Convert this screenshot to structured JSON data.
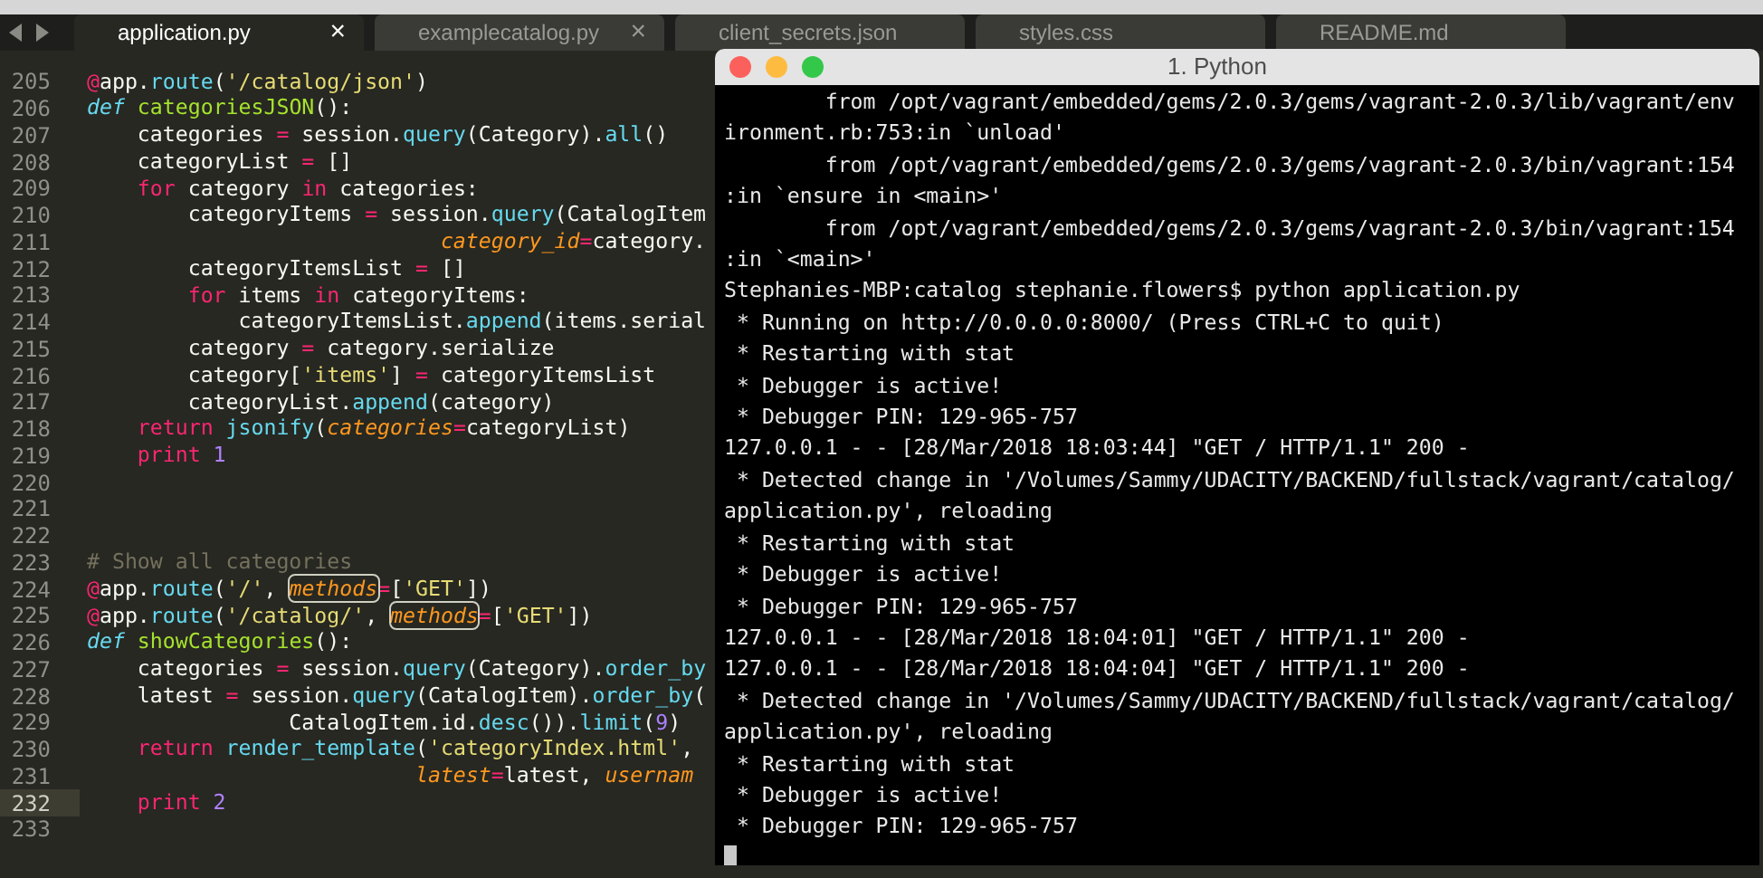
{
  "tabs": [
    {
      "label": "application.py",
      "selected": true,
      "close": "×"
    },
    {
      "label": "examplecatalog.py",
      "selected": false,
      "close": "×"
    },
    {
      "label": "client_secrets.json",
      "selected": false
    },
    {
      "label": "styles.css",
      "selected": false
    },
    {
      "label": "README.md",
      "selected": false
    }
  ],
  "editor": {
    "lines": [
      {
        "number": "205",
        "current": false,
        "tokens": [
          {
            "kind": "deco",
            "text": "@"
          },
          {
            "kind": "plain",
            "text": "app."
          },
          {
            "kind": "call",
            "text": "route"
          },
          {
            "kind": "plain",
            "text": "("
          },
          {
            "kind": "str",
            "text": "'/catalog/json'"
          },
          {
            "kind": "plain",
            "text": ")"
          }
        ]
      },
      {
        "number": "206",
        "current": false,
        "tokens": [
          {
            "kind": "storage",
            "text": "def"
          },
          {
            "kind": "fn",
            "text": " categoriesJSON"
          },
          {
            "kind": "plain",
            "text": "():"
          }
        ]
      },
      {
        "number": "207",
        "current": false,
        "tokens": [
          {
            "kind": "plain",
            "text": "    categories "
          },
          {
            "kind": "kw",
            "text": "="
          },
          {
            "kind": "plain",
            "text": " session."
          },
          {
            "kind": "call",
            "text": "query"
          },
          {
            "kind": "plain",
            "text": "(Category)."
          },
          {
            "kind": "call",
            "text": "all"
          },
          {
            "kind": "plain",
            "text": "()"
          }
        ]
      },
      {
        "number": "208",
        "current": false,
        "tokens": [
          {
            "kind": "plain",
            "text": "    categoryList "
          },
          {
            "kind": "kw",
            "text": "="
          },
          {
            "kind": "plain",
            "text": " []"
          }
        ]
      },
      {
        "number": "209",
        "current": false,
        "tokens": [
          {
            "kind": "kw",
            "text": "    for"
          },
          {
            "kind": "plain",
            "text": " category "
          },
          {
            "kind": "kw",
            "text": "in"
          },
          {
            "kind": "plain",
            "text": " categories:"
          }
        ]
      },
      {
        "number": "210",
        "current": false,
        "tokens": [
          {
            "kind": "plain",
            "text": "        categoryItems "
          },
          {
            "kind": "kw",
            "text": "="
          },
          {
            "kind": "plain",
            "text": " session."
          },
          {
            "kind": "call",
            "text": "query"
          },
          {
            "kind": "plain",
            "text": "(CatalogItem"
          }
        ]
      },
      {
        "number": "211",
        "current": false,
        "tokens": [
          {
            "kind": "param",
            "text": "                            category_id"
          },
          {
            "kind": "kw",
            "text": "="
          },
          {
            "kind": "plain",
            "text": "category."
          }
        ]
      },
      {
        "number": "212",
        "current": false,
        "tokens": [
          {
            "kind": "plain",
            "text": "        categoryItemsList "
          },
          {
            "kind": "kw",
            "text": "="
          },
          {
            "kind": "plain",
            "text": " []"
          }
        ]
      },
      {
        "number": "213",
        "current": false,
        "tokens": [
          {
            "kind": "kw",
            "text": "        for"
          },
          {
            "kind": "plain",
            "text": " items "
          },
          {
            "kind": "kw",
            "text": "in"
          },
          {
            "kind": "plain",
            "text": " categoryItems:"
          }
        ]
      },
      {
        "number": "214",
        "current": false,
        "tokens": [
          {
            "kind": "plain",
            "text": "            categoryItemsList."
          },
          {
            "kind": "call",
            "text": "append"
          },
          {
            "kind": "plain",
            "text": "(items.serial"
          }
        ]
      },
      {
        "number": "215",
        "current": false,
        "tokens": [
          {
            "kind": "plain",
            "text": "        category "
          },
          {
            "kind": "kw",
            "text": "="
          },
          {
            "kind": "plain",
            "text": " category.serialize"
          }
        ]
      },
      {
        "number": "216",
        "current": false,
        "tokens": [
          {
            "kind": "plain",
            "text": "        category["
          },
          {
            "kind": "str",
            "text": "'items'"
          },
          {
            "kind": "plain",
            "text": "] "
          },
          {
            "kind": "kw",
            "text": "="
          },
          {
            "kind": "plain",
            "text": " categoryItemsList"
          }
        ]
      },
      {
        "number": "217",
        "current": false,
        "tokens": [
          {
            "kind": "plain",
            "text": "        categoryList."
          },
          {
            "kind": "call",
            "text": "append"
          },
          {
            "kind": "plain",
            "text": "(category)"
          }
        ]
      },
      {
        "number": "218",
        "current": false,
        "tokens": [
          {
            "kind": "kw",
            "text": "    return"
          },
          {
            "kind": "call",
            "text": " jsonify"
          },
          {
            "kind": "plain",
            "text": "("
          },
          {
            "kind": "param",
            "text": "categories"
          },
          {
            "kind": "kw",
            "text": "="
          },
          {
            "kind": "plain",
            "text": "categoryList)"
          }
        ]
      },
      {
        "number": "219",
        "current": false,
        "tokens": [
          {
            "kind": "kw",
            "text": "    print"
          },
          {
            "kind": "num",
            "text": " 1"
          }
        ]
      },
      {
        "number": "220",
        "current": false
      },
      {
        "number": "221",
        "current": false
      },
      {
        "number": "222",
        "current": false
      },
      {
        "number": "223",
        "current": false,
        "tokens": [
          {
            "kind": "comment",
            "text": "# Show all categories"
          }
        ]
      },
      {
        "number": "224",
        "current": false,
        "tokens": [
          {
            "kind": "deco",
            "text": "@"
          },
          {
            "kind": "plain",
            "text": "app."
          },
          {
            "kind": "call",
            "text": "route"
          },
          {
            "kind": "plain",
            "text": "("
          },
          {
            "kind": "str",
            "text": "'/'"
          },
          {
            "kind": "plain",
            "text": ", "
          },
          {
            "kind": "param_marked",
            "text": "methods"
          },
          {
            "kind": "kw",
            "text": "="
          },
          {
            "kind": "plain",
            "text": "["
          },
          {
            "kind": "str",
            "text": "'GET'"
          },
          {
            "kind": "plain",
            "text": "])"
          }
        ]
      },
      {
        "number": "225",
        "current": false,
        "tokens": [
          {
            "kind": "deco",
            "text": "@"
          },
          {
            "kind": "plain",
            "text": "app."
          },
          {
            "kind": "call",
            "text": "route"
          },
          {
            "kind": "plain",
            "text": "("
          },
          {
            "kind": "str",
            "text": "'/catalog/'"
          },
          {
            "kind": "plain",
            "text": ", "
          },
          {
            "kind": "param_marked",
            "text": "methods"
          },
          {
            "kind": "kw",
            "text": "="
          },
          {
            "kind": "plain",
            "text": "["
          },
          {
            "kind": "str",
            "text": "'GET'"
          },
          {
            "kind": "plain",
            "text": "])"
          }
        ]
      },
      {
        "number": "226",
        "current": false,
        "tokens": [
          {
            "kind": "storage",
            "text": "def"
          },
          {
            "kind": "fn",
            "text": " showCategories"
          },
          {
            "kind": "plain",
            "text": "():"
          }
        ]
      },
      {
        "number": "227",
        "current": false,
        "tokens": [
          {
            "kind": "plain",
            "text": "    categories "
          },
          {
            "kind": "kw",
            "text": "="
          },
          {
            "kind": "plain",
            "text": " session."
          },
          {
            "kind": "call",
            "text": "query"
          },
          {
            "kind": "plain",
            "text": "(Category)."
          },
          {
            "kind": "call",
            "text": "order_by"
          }
        ]
      },
      {
        "number": "228",
        "current": false,
        "tokens": [
          {
            "kind": "plain",
            "text": "    latest "
          },
          {
            "kind": "kw",
            "text": "="
          },
          {
            "kind": "plain",
            "text": " session."
          },
          {
            "kind": "call",
            "text": "query"
          },
          {
            "kind": "plain",
            "text": "(CatalogItem)."
          },
          {
            "kind": "call",
            "text": "order_by"
          },
          {
            "kind": "plain",
            "text": "("
          }
        ]
      },
      {
        "number": "229",
        "current": false,
        "tokens": [
          {
            "kind": "plain",
            "text": "                CatalogItem.id."
          },
          {
            "kind": "call",
            "text": "desc"
          },
          {
            "kind": "plain",
            "text": "())."
          },
          {
            "kind": "call",
            "text": "limit"
          },
          {
            "kind": "plain",
            "text": "("
          },
          {
            "kind": "num",
            "text": "9"
          },
          {
            "kind": "plain",
            "text": ")"
          }
        ]
      },
      {
        "number": "230",
        "current": false,
        "tokens": [
          {
            "kind": "kw",
            "text": "    return"
          },
          {
            "kind": "call",
            "text": " render_template"
          },
          {
            "kind": "plain",
            "text": "("
          },
          {
            "kind": "str",
            "text": "'categoryIndex.html'"
          },
          {
            "kind": "plain",
            "text": ","
          }
        ]
      },
      {
        "number": "231",
        "current": false,
        "tokens": [
          {
            "kind": "param",
            "text": "                          latest"
          },
          {
            "kind": "kw",
            "text": "="
          },
          {
            "kind": "plain",
            "text": "latest, "
          },
          {
            "kind": "param",
            "text": "usernam"
          }
        ]
      },
      {
        "number": "232",
        "current": true,
        "tokens": [
          {
            "kind": "kw",
            "text": "    print"
          },
          {
            "kind": "num",
            "text": " 2"
          }
        ]
      },
      {
        "number": "233",
        "current": false
      }
    ]
  },
  "terminal": {
    "title": "1. Python",
    "lines": [
      "        from /opt/vagrant/embedded/gems/2.0.3/gems/vagrant-2.0.3/lib/vagrant/env",
      "ironment.rb:753:in `unload'",
      "        from /opt/vagrant/embedded/gems/2.0.3/gems/vagrant-2.0.3/bin/vagrant:154",
      ":in `ensure in <main>'",
      "        from /opt/vagrant/embedded/gems/2.0.3/gems/vagrant-2.0.3/bin/vagrant:154",
      ":in `<main>'",
      "Stephanies-MBP:catalog stephanie.flowers$ python application.py",
      " * Running on http://0.0.0.0:8000/ (Press CTRL+C to quit)",
      " * Restarting with stat",
      " * Debugger is active!",
      " * Debugger PIN: 129-965-757",
      "127.0.0.1 - - [28/Mar/2018 18:03:44] \"GET / HTTP/1.1\" 200 -",
      " * Detected change in '/Volumes/Sammy/UDACITY/BACKEND/fullstack/vagrant/catalog/",
      "application.py', reloading",
      " * Restarting with stat",
      " * Debugger is active!",
      " * Debugger PIN: 129-965-757",
      "127.0.0.1 - - [28/Mar/2018 18:04:01] \"GET / HTTP/1.1\" 200 -",
      "127.0.0.1 - - [28/Mar/2018 18:04:04] \"GET / HTTP/1.1\" 200 -",
      " * Detected change in '/Volumes/Sammy/UDACITY/BACKEND/fullstack/vagrant/catalog/",
      "application.py', reloading",
      " * Restarting with stat",
      " * Debugger is active!",
      " * Debugger PIN: 129-965-757"
    ]
  }
}
